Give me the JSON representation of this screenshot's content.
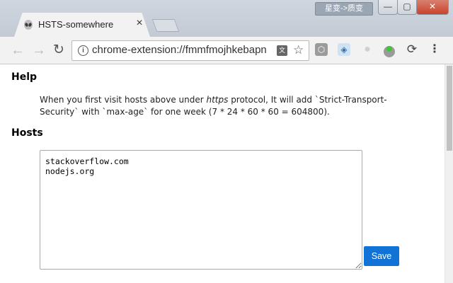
{
  "window": {
    "lang_indicator": "星变->质变",
    "minimize_glyph": "—",
    "maximize_glyph": "▢",
    "close_glyph": "✕"
  },
  "tab": {
    "title": "HSTS-somewhere",
    "close_glyph": "×",
    "favicon": "alien-icon"
  },
  "toolbar": {
    "back_glyph": "←",
    "forward_glyph": "→",
    "reload_glyph": "↻",
    "url": "chrome-extension://fmmfmojhkebapn",
    "info_glyph": "i",
    "translate_glyph": "文",
    "star_glyph": "☆",
    "extensions": [
      {
        "name": "ghostery-icon",
        "glyph": "⬡"
      },
      {
        "name": "translate-ext-icon",
        "glyph": "◈"
      },
      {
        "name": "disabled-ext-icon",
        "glyph": "●"
      },
      {
        "name": "green-dot-ext-icon",
        "glyph": ""
      },
      {
        "name": "sync-icon",
        "glyph": "⟳"
      }
    ],
    "menu_glyph": "⋮"
  },
  "help": {
    "heading": "Help",
    "text_before": "When you first visit hosts above under ",
    "text_italic": "https",
    "text_after": " protocol, It will add `Strict-Transport-Security` with `max-age` for one week (7 * 24 * 60 * 60 = 604800)."
  },
  "hosts": {
    "heading": "Hosts",
    "value": "stackoverflow.com\nnodejs.org",
    "save_label": "Save"
  }
}
